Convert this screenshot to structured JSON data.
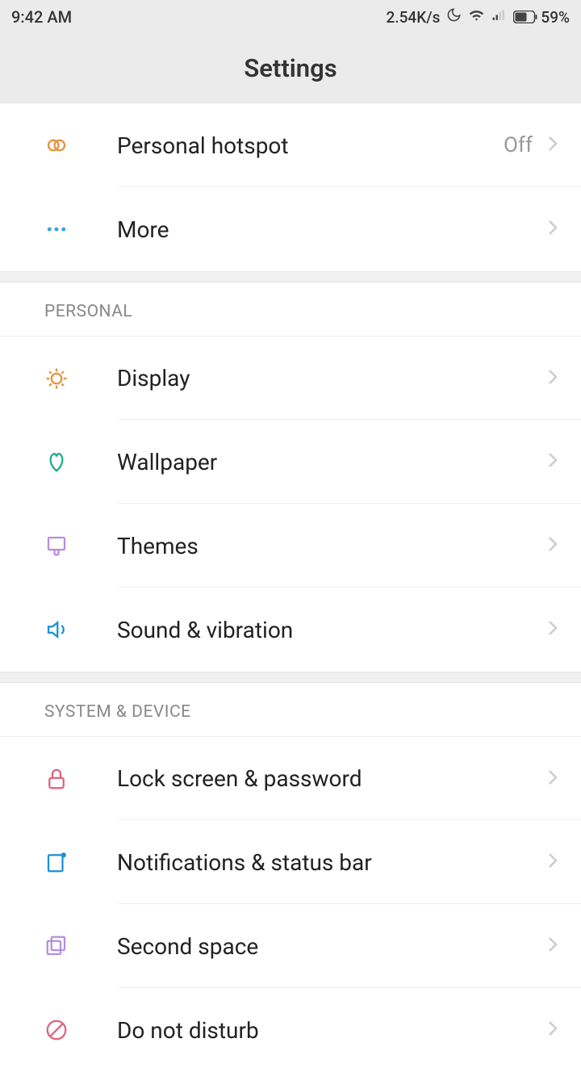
{
  "statusBar": {
    "time": "9:42 AM",
    "speed": "2.54K/s",
    "battery": "59%"
  },
  "header": {
    "title": "Settings"
  },
  "sections": {
    "networkTail": {
      "hotspot": {
        "label": "Personal hotspot",
        "value": "Off"
      },
      "more": {
        "label": "More"
      }
    },
    "personal": {
      "title": "PERSONAL",
      "display": {
        "label": "Display"
      },
      "wallpaper": {
        "label": "Wallpaper"
      },
      "themes": {
        "label": "Themes"
      },
      "sound": {
        "label": "Sound & vibration"
      }
    },
    "system": {
      "title": "SYSTEM & DEVICE",
      "lock": {
        "label": "Lock screen & password"
      },
      "notifications": {
        "label": "Notifications & status bar"
      },
      "secondSpace": {
        "label": "Second space"
      },
      "dnd": {
        "label": "Do not disturb"
      }
    }
  }
}
